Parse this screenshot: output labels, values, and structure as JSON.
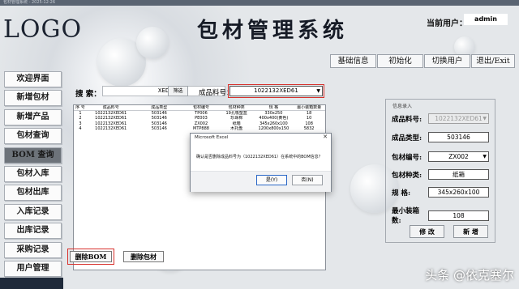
{
  "window": {
    "title": "包材管理系统 - 2025-12-26"
  },
  "header": {
    "logo": "LOGO",
    "system_title": "包材管理系统",
    "user_label": "当前用户：",
    "user_value": "admin"
  },
  "topnav": [
    "基础信息",
    "初始化",
    "切换用户",
    "退出/Exit"
  ],
  "sidebar": [
    "欢迎界面",
    "新增包材",
    "新增产品",
    "包材查询",
    "BOM 查询",
    "包材入库",
    "包材出库",
    "入库记录",
    "出库记录",
    "采购记录",
    "用户管理"
  ],
  "search": {
    "label": "搜 索：",
    "value": "XED",
    "filter_btn": "筛选",
    "product_label": "成品料号：",
    "product_value": "1022132XED61"
  },
  "table": {
    "headers": [
      "序 号",
      "成品料号",
      "成品类型",
      "包材编号",
      "包材种类",
      "规 格",
      "最小装箱数量"
    ],
    "rows": [
      [
        "1",
        "1022132XED61",
        "503146",
        "TP006",
        "19孔吸塑盒",
        "330x250",
        "18"
      ],
      [
        "2",
        "1022132XED61",
        "503146",
        "PE003",
        "珍珠棉",
        "400x400(黄色)",
        "10"
      ],
      [
        "3",
        "1022132XED61",
        "503146",
        "ZX002",
        "纸箱",
        "345x260x100",
        "108"
      ],
      [
        "4",
        "1022132XED61",
        "503146",
        "MTP888",
        "木托盘",
        "1200x800x150",
        "5832"
      ]
    ]
  },
  "actions": {
    "delete_bom": "删除BOM",
    "delete_material": "删除包材"
  },
  "panel": {
    "title": "信息录入",
    "fields": [
      {
        "label": "成品料号:",
        "value": "1022132XED61"
      },
      {
        "label": "成品类型:",
        "value": "503146"
      },
      {
        "label": "包材编号:",
        "value": "ZX002"
      },
      {
        "label": "包材种类:",
        "value": "纸箱"
      },
      {
        "label": "规  格:",
        "value": "345x260x100"
      },
      {
        "label": "最小装箱数:",
        "value": "108"
      }
    ],
    "edit_btn": "修 改",
    "add_btn": "新 增"
  },
  "dialog": {
    "title": "Microsoft Excel",
    "message": "确认是否删除成品料号为（1022132XED61）在系统中的BOM信息？",
    "yes": "是(Y)",
    "no": "否(N)",
    "close": "✕"
  },
  "watermark": "头条 @依克塞尔"
}
